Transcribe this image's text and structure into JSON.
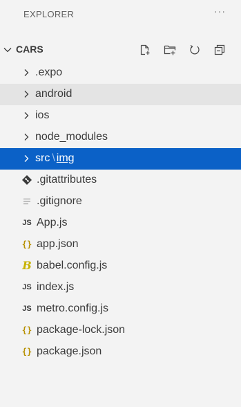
{
  "header": {
    "title": "EXPLORER",
    "more_label": "···"
  },
  "section": {
    "title": "CARS",
    "actions": [
      "new-file-icon",
      "new-folder-icon",
      "refresh-icon",
      "collapse-all-icon"
    ]
  },
  "tree": {
    "folders": [
      {
        "label": ".expo"
      },
      {
        "label": "android"
      },
      {
        "label": "ios"
      },
      {
        "label": "node_modules"
      },
      {
        "label_part1": "src",
        "separator": "\\",
        "label_part2": "img"
      }
    ],
    "files": [
      {
        "label": ".gitattributes",
        "icon": "git-icon"
      },
      {
        "label": ".gitignore",
        "icon": "gitignore-icon"
      },
      {
        "label": "App.js",
        "icon": "js-icon",
        "icon_text": "JS"
      },
      {
        "label": "app.json",
        "icon": "json-icon",
        "icon_text": "{}"
      },
      {
        "label": "babel.config.js",
        "icon": "babel-icon",
        "icon_text": "B"
      },
      {
        "label": "index.js",
        "icon": "js-icon",
        "icon_text": "JS"
      },
      {
        "label": "metro.config.js",
        "icon": "js-icon",
        "icon_text": "JS"
      },
      {
        "label": "package-lock.json",
        "icon": "json-icon",
        "icon_text": "{}"
      },
      {
        "label": "package.json",
        "icon": "json-icon",
        "icon_text": "{}"
      }
    ]
  },
  "colors": {
    "background": "#f3f3f3",
    "hover": "#e4e4e4",
    "selected": "#0b61c7",
    "json_icon": "#b89100",
    "babel_icon": "#c8b200"
  }
}
